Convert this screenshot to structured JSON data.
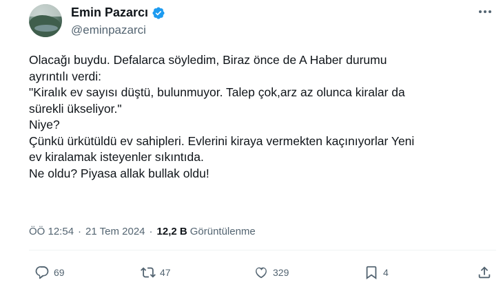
{
  "author": {
    "display_name": "Emin Pazarcı",
    "handle": "@eminpazarci"
  },
  "tweet": {
    "lines": [
      "Olacağı buydu. Defalarca söyledim, Biraz önce de A Haber durumu",
      "ayrıntılı verdi:",
      "\"Kiralık ev sayısı düştü, bulunmuyor. Talep çok,arz az olunca kiralar da",
      "sürekli ükseliyor.\"",
      "Niye?",
      "Çünkü ürkütüldü ev sahipleri.  Evlerini kiraya vermekten kaçınıyorlar  Yeni",
      "ev kiralamak isteyenler sıkıntıda.",
      "Ne oldu? Piyasa allak bullak oldu!"
    ]
  },
  "meta": {
    "time": "ÖÖ 12:54",
    "date": "21 Tem 2024",
    "views_count": "12,2 B",
    "views_label": "Görüntülenme",
    "separator": "·"
  },
  "actions": {
    "replies": "69",
    "reposts": "47",
    "likes": "329",
    "bookmarks": "4"
  },
  "colors": {
    "text": "#0f1419",
    "secondary": "#536471",
    "verified": "#1d9bf0",
    "divider": "#eff3f4"
  }
}
